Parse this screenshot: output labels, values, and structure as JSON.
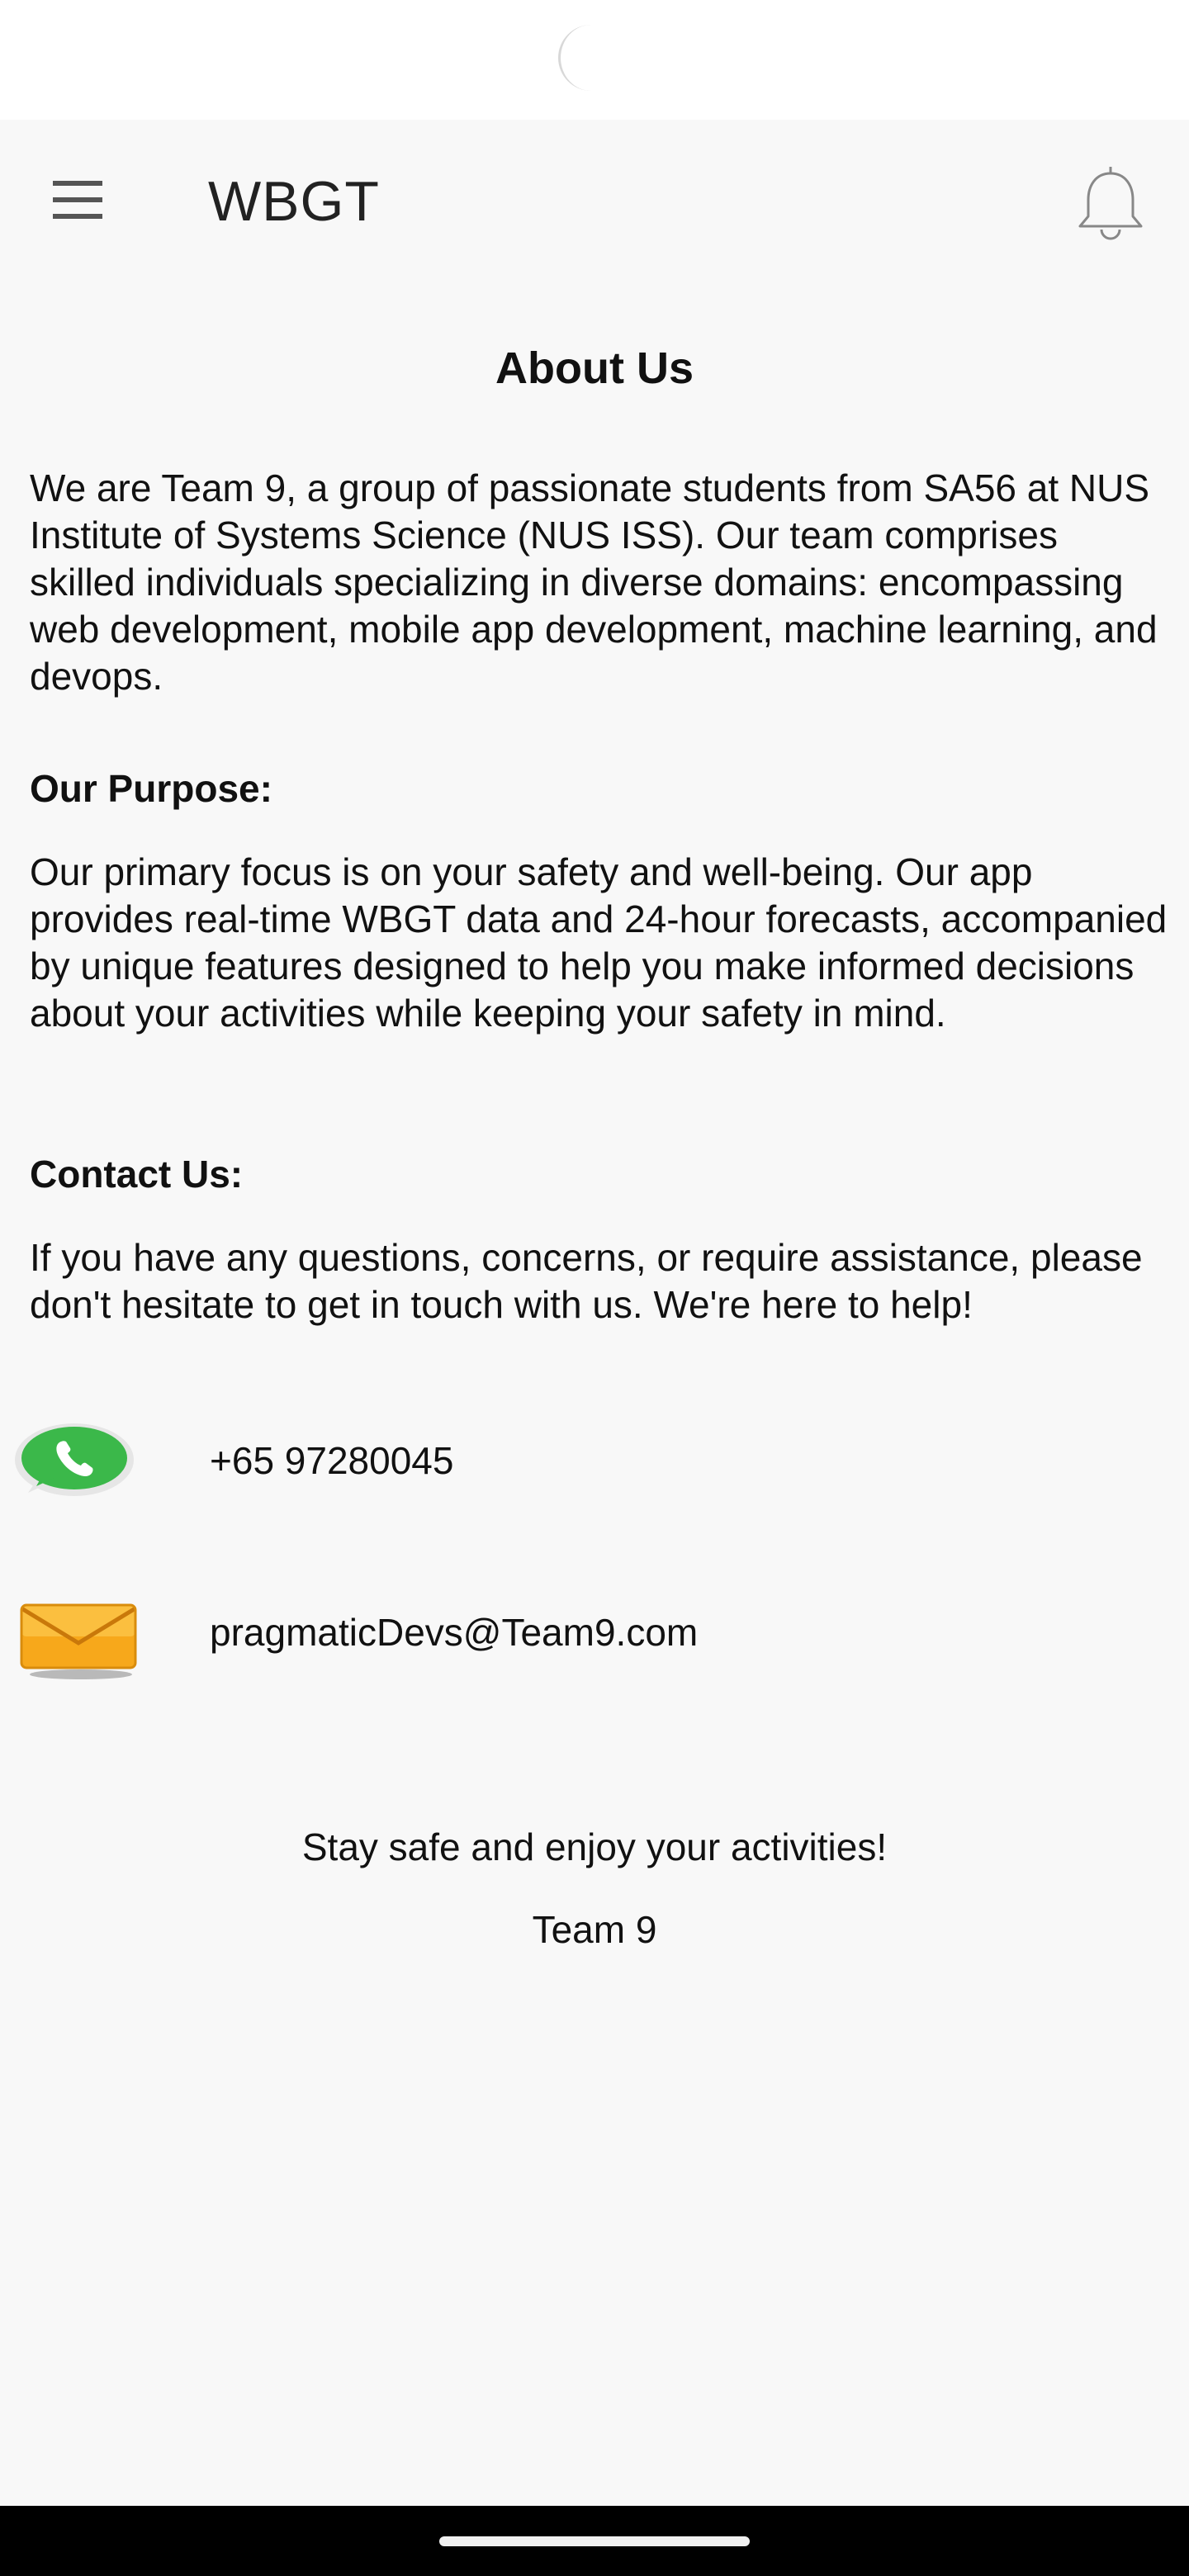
{
  "app_bar": {
    "title": "WBGT",
    "menu_icon": "hamburger-menu-icon",
    "notification_icon": "bell-icon"
  },
  "page": {
    "title": "About Us",
    "intro": "We are Team 9, a group of passionate students from SA56 at NUS Institute of Systems Science (NUS ISS). Our team comprises skilled individuals specializing in diverse domains: encompassing web development, mobile app development, machine learning, and devops.",
    "purpose_heading": "Our Purpose:",
    "purpose_text": "Our primary focus is on your safety and well-being. Our app provides real-time WBGT data and 24-hour forecasts, accompanied by unique features designed to help you make informed decisions about your activities while keeping your safety in mind.",
    "contact_heading": "Contact Us:",
    "contact_text": "If you have any questions, concerns, or require assistance, please don't hesitate to get in touch with us. We're here to help!"
  },
  "contacts": {
    "phone": {
      "icon": "whatsapp-icon",
      "value": "+65 97280045"
    },
    "email": {
      "icon": "email-envelope-icon",
      "value": "pragmaticDevs@Team9.com"
    }
  },
  "footer": {
    "message": "Stay safe and enjoy your activities!",
    "signature": "Team 9"
  },
  "colors": {
    "background": "#f8f8f8",
    "whatsapp_green": "#3bb84a",
    "envelope_orange": "#f7a81b"
  }
}
